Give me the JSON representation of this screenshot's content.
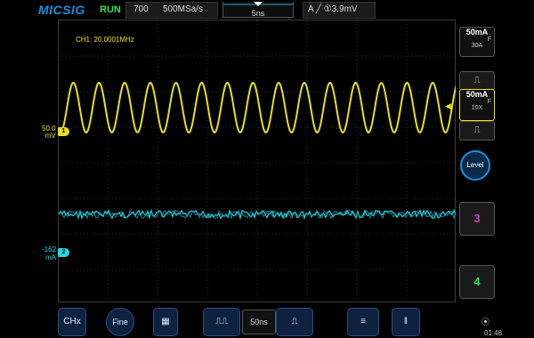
{
  "topbar": {
    "logo": "MICSIG",
    "run_status": "RUN",
    "memory_depth": "700",
    "sample_rate": "500MSa/s",
    "timebase": "5ns",
    "trigger_mode": "A",
    "trigger_slope_icon": "rising-edge-icon",
    "trigger_level": "①3.9mV"
  },
  "screen": {
    "frequency_readout": "CH1: 20.0001MHz",
    "ch1_scale_line1": "50.0",
    "ch1_scale_line2": "mV",
    "ch1_marker": "1",
    "ch2_scale_line1": "-162",
    "ch2_scale_line2": "mA",
    "ch2_marker": "2",
    "ch1_color": "#e9e01a",
    "ch2_color": "#21d8e6"
  },
  "right_panel": {
    "ch_box1": {
      "value": "50mA",
      "coupling": "F",
      "probe": "30A"
    },
    "ch_box2": {
      "value": "50mA",
      "coupling": "F",
      "probe": "10X"
    },
    "level_button": "Level",
    "ch3_button": "3",
    "ch4_button": "4",
    "ch3_color": "#d23ad6",
    "ch4_color": "#2ee05a"
  },
  "bottom_bar": {
    "chx_button": "CHx",
    "fine_button": "Fine",
    "timebase_value": "50ns",
    "clock": "01:48"
  }
}
